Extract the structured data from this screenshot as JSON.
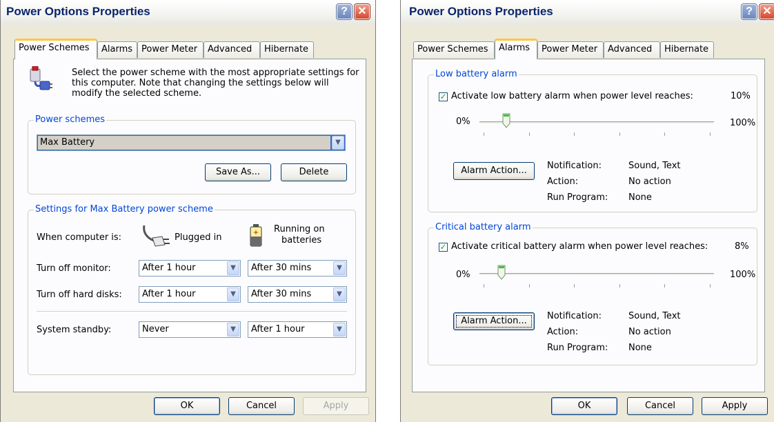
{
  "left_window": {
    "title": "Power Options Properties",
    "help_glyph": "?",
    "close_glyph": "✕",
    "tabs": [
      "Power Schemes",
      "Alarms",
      "Power Meter",
      "Advanced",
      "Hibernate"
    ],
    "active_tab": "Power Schemes",
    "intro_text": "Select the power scheme with the most appropriate settings for this computer. Note that changing the settings below will modify the selected scheme.",
    "power_schemes": {
      "legend": "Power schemes",
      "selected": "Max Battery",
      "save_as_label": "Save As...",
      "delete_label": "Delete"
    },
    "settings": {
      "legend": "Settings for Max Battery power scheme",
      "when_label": "When computer is:",
      "plugged_in_label": "Plugged in",
      "batteries_label_1": "Running on",
      "batteries_label_2": "batteries",
      "rows": [
        {
          "label": "Turn off monitor:",
          "plugged": "After 1 hour",
          "battery": "After 30 mins"
        },
        {
          "label": "Turn off hard disks:",
          "plugged": "After 1 hour",
          "battery": "After 30 mins"
        },
        {
          "label": "System standby:",
          "plugged": "Never",
          "battery": "After 1 hour"
        }
      ]
    },
    "buttons": {
      "ok": "OK",
      "cancel": "Cancel",
      "apply": "Apply"
    }
  },
  "right_window": {
    "title": "Power Options Properties",
    "help_glyph": "?",
    "close_glyph": "✕",
    "tabs": [
      "Power Schemes",
      "Alarms",
      "Power Meter",
      "Advanced",
      "Hibernate"
    ],
    "active_tab": "Alarms",
    "low_alarm": {
      "legend": "Low battery alarm",
      "checkbox_label": "Activate low battery alarm when power level reaches:",
      "checked": true,
      "level_text": "10%",
      "level_value": 10,
      "min_label": "0%",
      "max_label": "100%",
      "alarm_action_label": "Alarm Action...",
      "notification_label": "Notification:",
      "notification_value": "Sound, Text",
      "action_label": "Action:",
      "action_value": "No action",
      "run_program_label": "Run Program:",
      "run_program_value": "None"
    },
    "critical_alarm": {
      "legend": "Critical battery alarm",
      "checkbox_label": "Activate critical battery alarm when power level reaches:",
      "checked": true,
      "level_text": "8%",
      "level_value": 8,
      "min_label": "0%",
      "max_label": "100%",
      "alarm_action_label": "Alarm Action...",
      "notification_label": "Notification:",
      "notification_value": "Sound, Text",
      "action_label": "Action:",
      "action_value": "No action",
      "run_program_label": "Run Program:",
      "run_program_value": "None"
    },
    "buttons": {
      "ok": "OK",
      "cancel": "Cancel",
      "apply": "Apply"
    }
  },
  "colors": {
    "accent": "#0046d5",
    "title": "#0a246a",
    "tab_highlight": "#ffc83c",
    "selection": "#316ac5"
  }
}
